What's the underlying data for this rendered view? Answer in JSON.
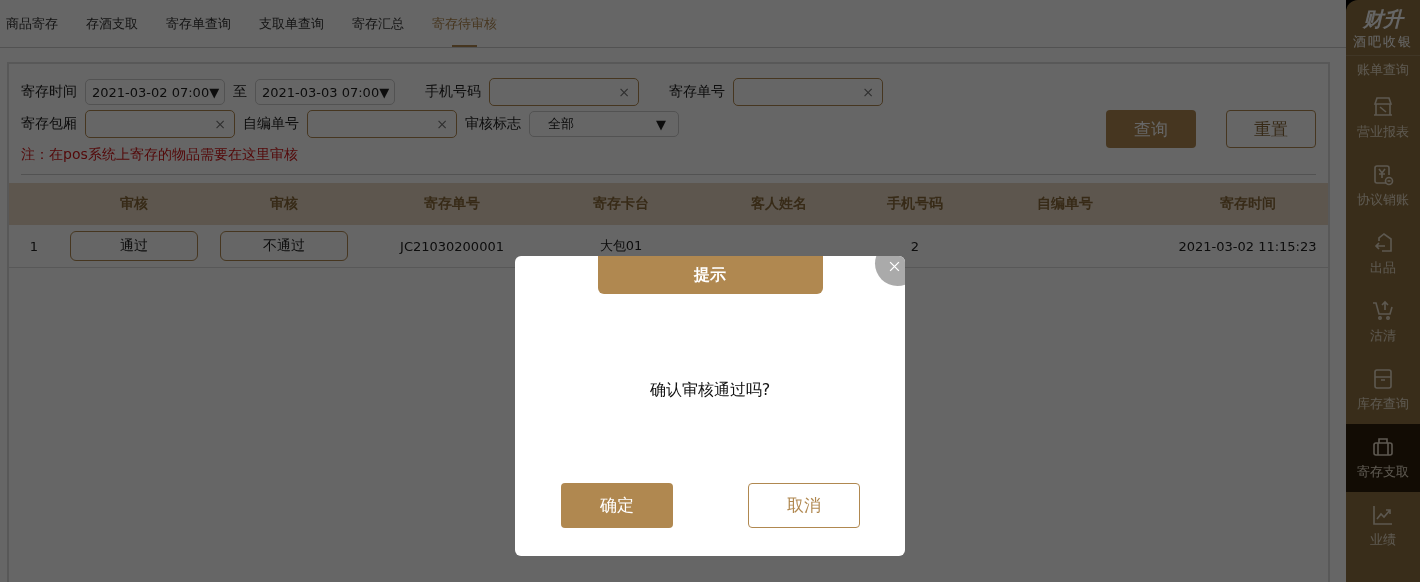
{
  "tabs": [
    {
      "label": "商品寄存",
      "selected": false
    },
    {
      "label": "存酒支取",
      "selected": false
    },
    {
      "label": "寄存单查询",
      "selected": false
    },
    {
      "label": "支取单查询",
      "selected": false
    },
    {
      "label": "寄存汇总",
      "selected": false
    },
    {
      "label": "寄存待审核",
      "selected": true
    }
  ],
  "filters": {
    "date_label": "寄存时间",
    "date_from": "2021-03-02 07:00",
    "to_label": "至",
    "date_to": "2021-03-03 07:00",
    "phone_label": "手机号码",
    "order_label": "寄存单号",
    "room_label": "寄存包厢",
    "self_label": "自编单号",
    "flag_label": "审核标志",
    "flag_value": "全部",
    "clear_mark": "×",
    "caret": "▼",
    "query_button": "查询",
    "reset_button": "重置",
    "note": "注：在pos系统上寄存的物品需要在这里审核"
  },
  "table": {
    "columns": [
      "审核",
      "审核",
      "寄存单号",
      "寄存卡台",
      "客人姓名",
      "手机号码",
      "自编单号",
      "寄存时间"
    ],
    "rows": [
      {
        "index": "1",
        "pass": "通过",
        "reject": "不通过",
        "order_no": "JC21030200001",
        "table": "大包01",
        "phone": "2",
        "time": "2021-03-02 11:15:23"
      }
    ]
  },
  "sidebar": {
    "brand": "财升",
    "subtitle": "酒吧收银",
    "items": [
      {
        "label": "账单查询",
        "selected": false
      },
      {
        "label": "营业报表",
        "kind": "shop",
        "selected": false
      },
      {
        "label": "协议销账",
        "kind": "voucher",
        "selected": false
      },
      {
        "label": "出品",
        "kind": "return",
        "selected": false
      },
      {
        "label": "沽清",
        "kind": "cart",
        "selected": false
      },
      {
        "label": "库存查询",
        "kind": "box",
        "selected": false
      },
      {
        "label": "寄存支取",
        "kind": "case",
        "selected": true
      },
      {
        "label": "业绩",
        "kind": "chart",
        "selected": false
      }
    ]
  },
  "dialog": {
    "title": "提示",
    "message": "确认审核通过吗?",
    "confirm": "确定",
    "cancel": "取消"
  }
}
